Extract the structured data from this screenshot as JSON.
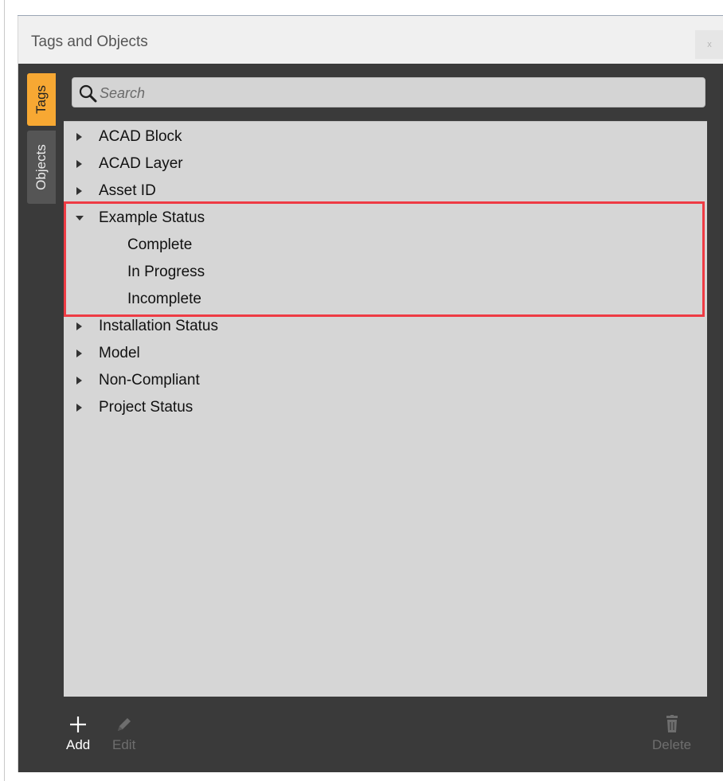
{
  "window": {
    "title": "Tags and Objects",
    "close_label": "x"
  },
  "tabs": [
    {
      "label": "Tags",
      "active": true
    },
    {
      "label": "Objects",
      "active": false
    }
  ],
  "search": {
    "placeholder": "Search",
    "value": ""
  },
  "tree": {
    "items": [
      {
        "label": "ACAD Block",
        "expanded": false
      },
      {
        "label": "ACAD Layer",
        "expanded": false
      },
      {
        "label": "Asset ID",
        "expanded": false
      },
      {
        "label": "Example Status",
        "expanded": true,
        "children": [
          "Complete",
          "In Progress",
          "Incomplete"
        ]
      },
      {
        "label": "Installation Status",
        "expanded": false
      },
      {
        "label": "Model",
        "expanded": false
      },
      {
        "label": "Non-Compliant",
        "expanded": false
      },
      {
        "label": "Project Status",
        "expanded": false
      }
    ]
  },
  "toolbar": {
    "add_label": "Add",
    "edit_label": "Edit",
    "delete_label": "Delete"
  },
  "colors": {
    "active_tab": "#f7a833",
    "highlight": "#ee3b44",
    "panel_bg": "#3a3a3a",
    "tree_bg": "#d6d6d6"
  },
  "icons": {
    "add": "plus-icon",
    "edit": "pencil-icon",
    "delete": "trash-icon",
    "search": "magnifier-icon"
  }
}
